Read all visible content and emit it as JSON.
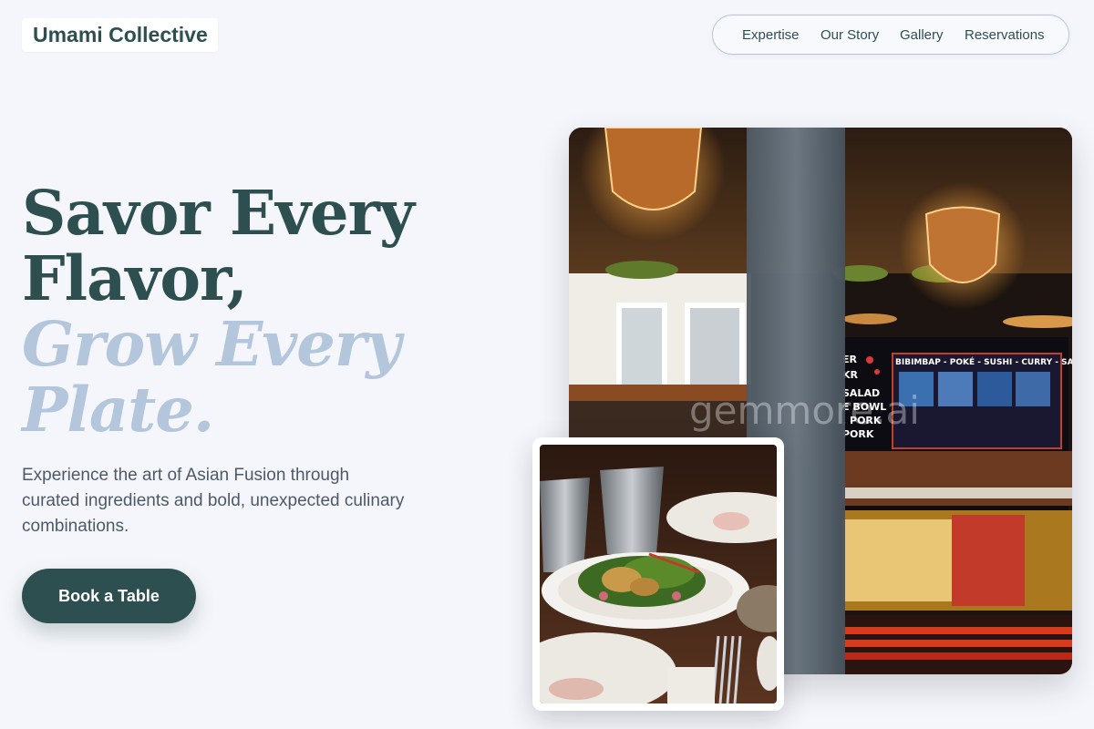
{
  "brand": {
    "name": "Umami Collective"
  },
  "nav": {
    "items": [
      {
        "label": "Expertise"
      },
      {
        "label": "Our Story"
      },
      {
        "label": "Gallery"
      },
      {
        "label": "Reservations"
      }
    ]
  },
  "hero": {
    "headline_line1": "Savor Every",
    "headline_line2": "Flavor,",
    "headline_line3": "Grow Every",
    "headline_line4": "Plate.",
    "subtitle": "Experience the art of Asian Fusion through curated ingredients and bold, unexpected culinary combinations.",
    "cta_label": "Book a Table"
  },
  "images": {
    "restaurant_menu_board": "BIBIMBAP - POKÉ - SUSHI - CURRY - SATAY",
    "restaurant_menu_side": [
      "ER",
      "KR",
      "SALAD",
      "E BOWL",
      ", PORK",
      "PORK"
    ],
    "restaurant_watermark": "gemmore.ai"
  },
  "colors": {
    "primary": "#2e4f50",
    "accent_light": "#b3c6dc",
    "background": "#f5f6fb",
    "text_muted": "#4d5a66"
  }
}
